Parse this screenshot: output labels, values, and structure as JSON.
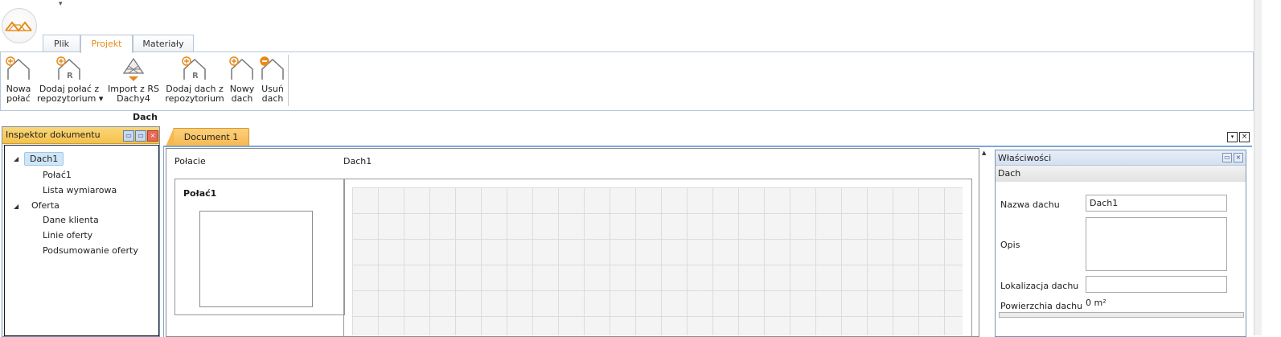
{
  "app": {
    "logo_icon": "roof-logo-icon",
    "qat_arrow": "▾",
    "accent": "#e88a1a"
  },
  "ribbon_tabs": [
    {
      "label": "Plik"
    },
    {
      "label": "Projekt"
    },
    {
      "label": "Materiały"
    }
  ],
  "ribbon": {
    "buttons": [
      {
        "line1": "Nowa",
        "line2": "połać",
        "icon": "new-roof-plane-icon"
      },
      {
        "line1": "Dodaj połać z",
        "line2": "repozytorium ▾",
        "icon": "add-plane-from-repo-icon"
      },
      {
        "line1": "Import z RS",
        "line2": "Dachy4",
        "icon": "import-rs-icon"
      },
      {
        "line1": "Dodaj dach z",
        "line2": "repozytorium",
        "icon": "add-roof-from-repo-icon"
      },
      {
        "line1": "Nowy",
        "line2": "dach",
        "icon": "new-roof-icon"
      },
      {
        "line1": "Usuń",
        "line2": "dach",
        "icon": "delete-roof-icon"
      }
    ],
    "group_label": "Dach"
  },
  "inspector": {
    "title": "Inspektor dokumentu",
    "tree": {
      "n1": "Dach1",
      "n2": "Połać1",
      "n3": "Lista wymiarowa",
      "n4": "Oferta",
      "n5": "Dane klienta",
      "n6": "Linie oferty",
      "n7": "Podsumowanie oferty"
    }
  },
  "document": {
    "tab": "Document 1",
    "dropdown_glyph": "▾",
    "close_glyph": "×",
    "labels": {
      "polacie": "Połacie",
      "dach": "Dach1"
    },
    "plane_title": "Połać1"
  },
  "properties": {
    "title": "Właściwości",
    "section": "Dach",
    "name_label": "Nazwa dachu",
    "name_value": "Dach1",
    "desc_label": "Opis",
    "desc_value": "",
    "loc_label": "Lokalizacja dachu",
    "loc_value": "",
    "area_label": "Powierzchia dachu",
    "area_value": "0 m²"
  }
}
